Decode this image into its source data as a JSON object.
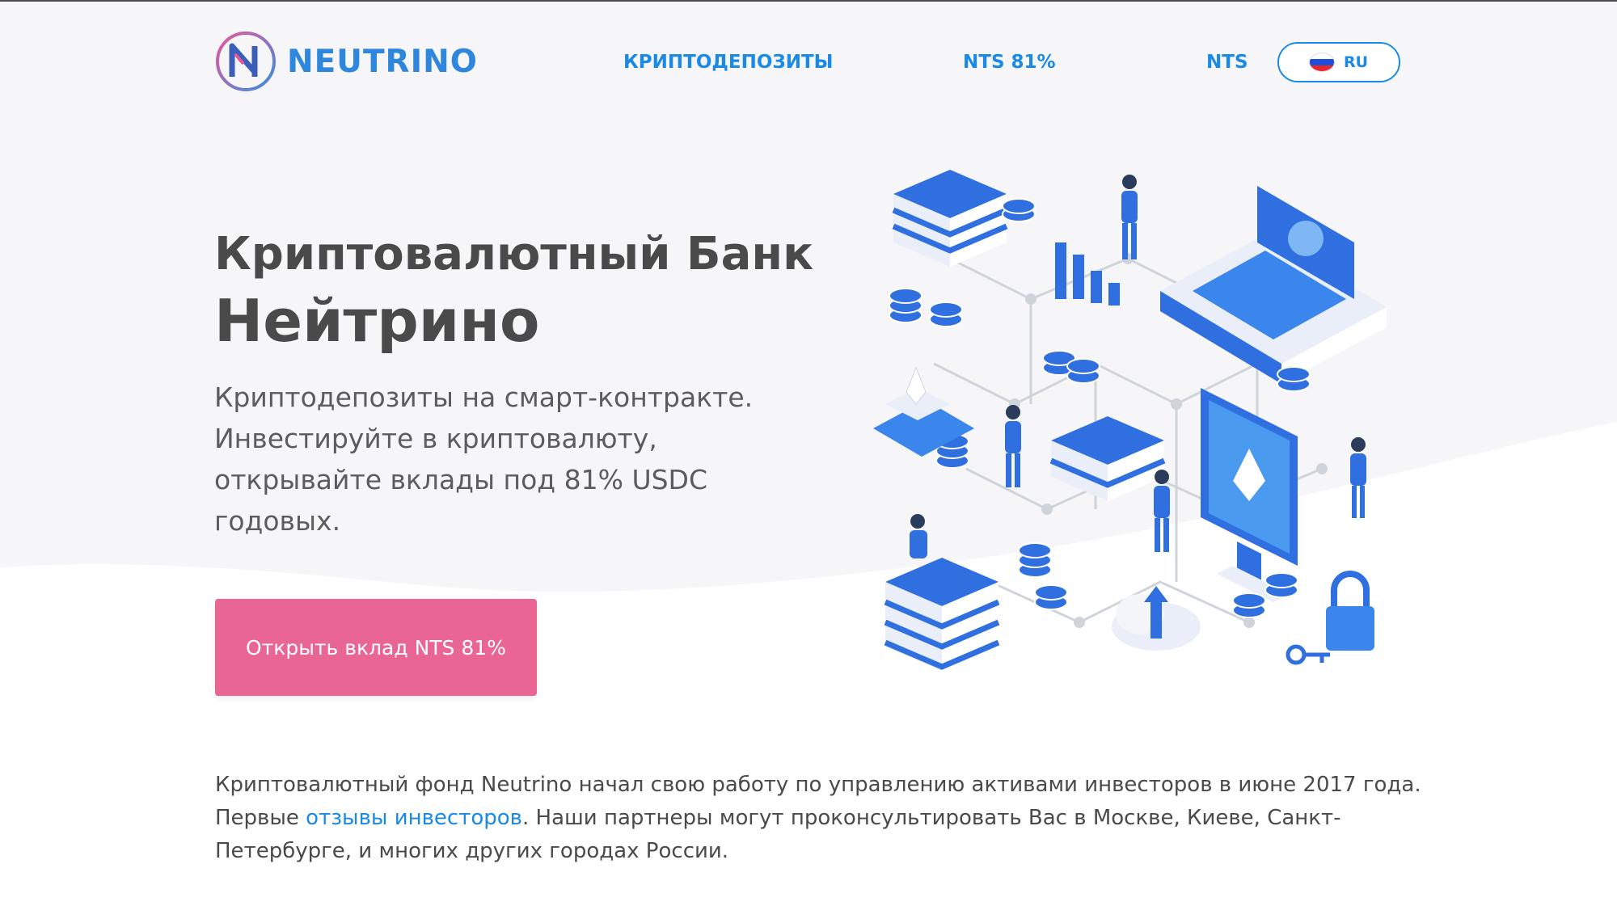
{
  "header": {
    "logo_text": "NEUTRINO",
    "nav": [
      {
        "label": "КРИПТОДЕПОЗИТЫ"
      },
      {
        "label": "NTS 81%"
      },
      {
        "label": "NTS"
      }
    ],
    "language": {
      "label": "RU",
      "flag_icon": "russia-flag-icon"
    }
  },
  "hero": {
    "title_line1": "Криптовалютный Банк",
    "title_line2": "Нейтрино",
    "subtitle": "Криптодепозиты на смарт-контракте. Инвестируйте в криптовалюту, открывайте вклады под 81% USDC годовых.",
    "cta_label": "Открыть вклад NTS 81%"
  },
  "about": {
    "text_before_link": "Криптовалютный фонд Neutrino начал свою работу по управлению активами инвесторов в июне 2017 года. Первые ",
    "link_text": "отзывы инвесторов",
    "text_after_link": ". Наши партнеры могут проконсультировать Вас в Москве, Киеве, Санкт-Петербурге, и многих других городах России."
  },
  "colors": {
    "brand_blue": "#1a8ae6",
    "cta_pink": "#e96593",
    "text_gray": "#4a4a4a",
    "hero_background": "#f6f6f9"
  }
}
